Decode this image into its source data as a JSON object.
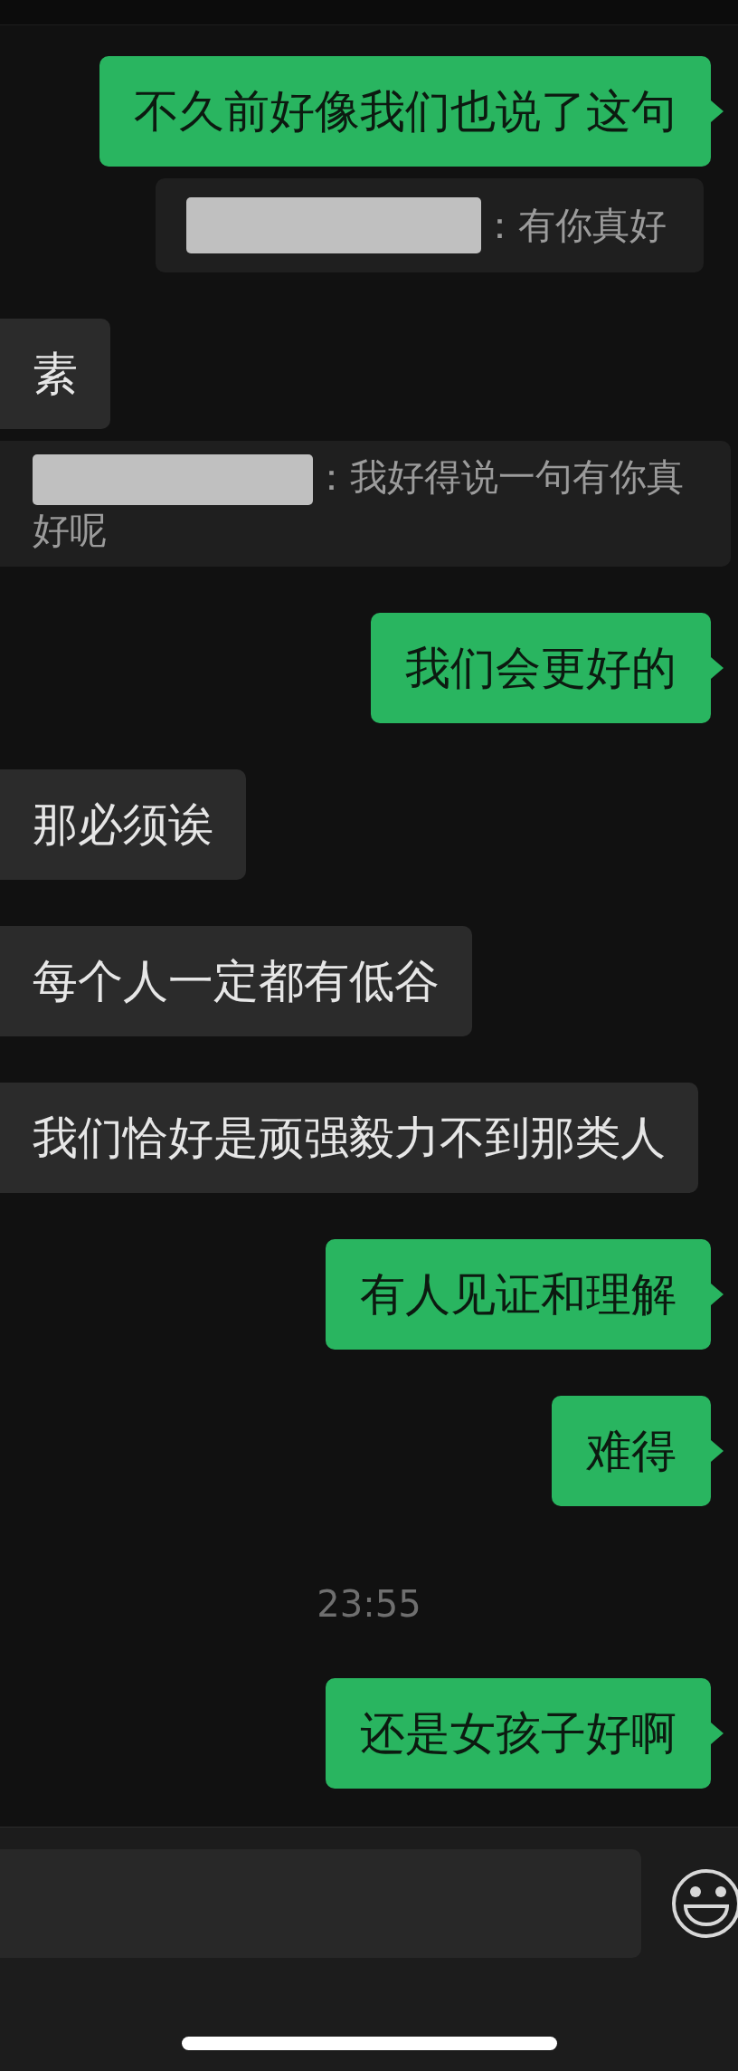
{
  "messages": [
    {
      "kind": "sent",
      "text": "不久前好像我们也说了这句"
    },
    {
      "kind": "quote_sent",
      "text": "：有你真好"
    },
    {
      "kind": "received",
      "text": "素"
    },
    {
      "kind": "quote_received",
      "text": "：我好得说一句有你真好呢"
    },
    {
      "kind": "sent",
      "text": "我们会更好的"
    },
    {
      "kind": "received",
      "text": "那必须诶"
    },
    {
      "kind": "received",
      "text": "每个人一定都有低谷"
    },
    {
      "kind": "received",
      "text": "我们恰好是顽强毅力不到那类人"
    },
    {
      "kind": "sent",
      "text": "有人见证和理解"
    },
    {
      "kind": "sent",
      "text": "难得"
    },
    {
      "kind": "time",
      "text": "23:55"
    },
    {
      "kind": "sent",
      "text": "还是女孩子好啊"
    }
  ]
}
